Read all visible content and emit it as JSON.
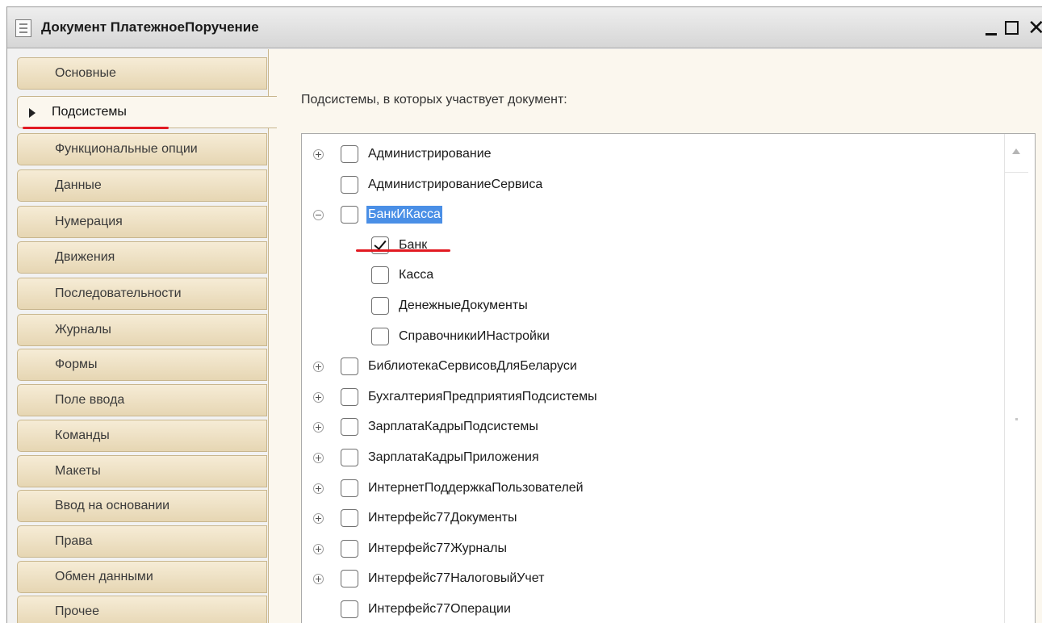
{
  "window": {
    "title": "Документ ПлатежноеПоручение",
    "close_glyph": "✕"
  },
  "tabs": [
    {
      "label": "Основные",
      "active": false
    },
    {
      "label": "Подсистемы",
      "active": true
    },
    {
      "label": "Функциональные опции",
      "active": false
    },
    {
      "label": "Данные",
      "active": false
    },
    {
      "label": "Нумерация",
      "active": false
    },
    {
      "label": "Движения",
      "active": false
    },
    {
      "label": "Последовательности",
      "active": false
    },
    {
      "label": "Журналы",
      "active": false
    },
    {
      "label": "Формы",
      "active": false
    },
    {
      "label": "Поле ввода",
      "active": false
    },
    {
      "label": "Команды",
      "active": false
    },
    {
      "label": "Макеты",
      "active": false
    },
    {
      "label": "Ввод на основании",
      "active": false
    },
    {
      "label": "Права",
      "active": false
    },
    {
      "label": "Обмен данными",
      "active": false
    },
    {
      "label": "Прочее",
      "active": false
    }
  ],
  "content": {
    "heading": "Подсистемы, в которых участвует документ:"
  },
  "tree": [
    {
      "label": "Администрирование",
      "level": 0,
      "toggle": "plus",
      "checked": false,
      "selected": false
    },
    {
      "label": "АдминистрированиеСервиса",
      "level": 0,
      "toggle": "none",
      "checked": false,
      "selected": false
    },
    {
      "label": "БанкИКасса",
      "level": 0,
      "toggle": "minus",
      "checked": false,
      "selected": true
    },
    {
      "label": "Банк",
      "level": 1,
      "toggle": "none",
      "checked": true,
      "selected": false
    },
    {
      "label": "Касса",
      "level": 1,
      "toggle": "none",
      "checked": false,
      "selected": false
    },
    {
      "label": "ДенежныеДокументы",
      "level": 1,
      "toggle": "none",
      "checked": false,
      "selected": false
    },
    {
      "label": "СправочникиИНастройки",
      "level": 1,
      "toggle": "none",
      "checked": false,
      "selected": false
    },
    {
      "label": "БиблиотекаСервисовДляБеларуси",
      "level": 0,
      "toggle": "plus",
      "checked": false,
      "selected": false
    },
    {
      "label": "БухгалтерияПредприятияПодсистемы",
      "level": 0,
      "toggle": "plus",
      "checked": false,
      "selected": false
    },
    {
      "label": "ЗарплатаКадрыПодсистемы",
      "level": 0,
      "toggle": "plus",
      "checked": false,
      "selected": false
    },
    {
      "label": "ЗарплатаКадрыПриложения",
      "level": 0,
      "toggle": "plus",
      "checked": false,
      "selected": false
    },
    {
      "label": "ИнтернетПоддержкаПользователей",
      "level": 0,
      "toggle": "plus",
      "checked": false,
      "selected": false
    },
    {
      "label": "Интерфейс77Документы",
      "level": 0,
      "toggle": "plus",
      "checked": false,
      "selected": false
    },
    {
      "label": "Интерфейс77Журналы",
      "level": 0,
      "toggle": "plus",
      "checked": false,
      "selected": false
    },
    {
      "label": "Интерфейс77НалоговыйУчет",
      "level": 0,
      "toggle": "plus",
      "checked": false,
      "selected": false
    },
    {
      "label": "Интерфейс77Операции",
      "level": 0,
      "toggle": "none",
      "checked": false,
      "selected": false
    }
  ],
  "colors": {
    "tab_bg": "#e6d6b3",
    "panel_bg": "#fbf7ee",
    "selection": "#4a8fe6",
    "annotation": "#e21a22"
  }
}
